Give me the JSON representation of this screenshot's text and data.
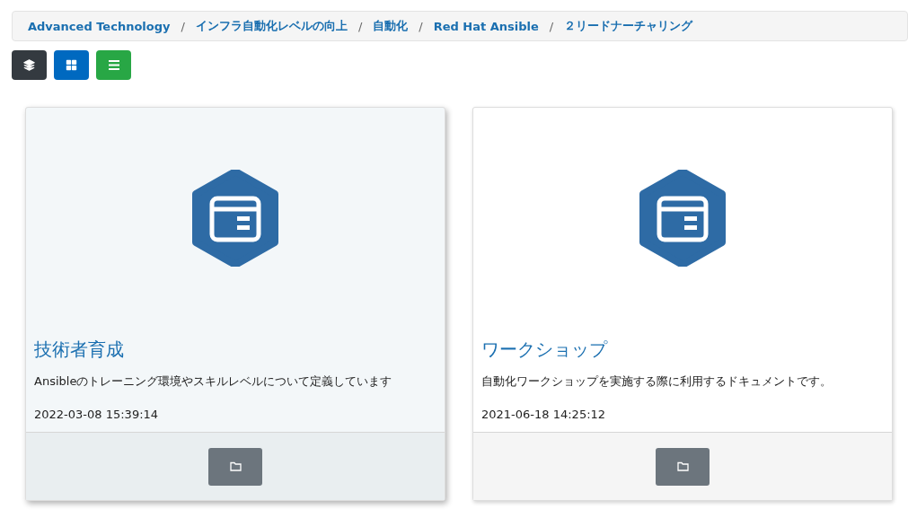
{
  "breadcrumb": [
    {
      "label": "Advanced Technology"
    },
    {
      "separator": "/",
      "label": "インフラ自動化レベルの向上"
    },
    {
      "separator": "/",
      "label": "自動化"
    },
    {
      "separator": "/",
      "label": "Red Hat Ansible"
    },
    {
      "separator": "/",
      "label": "２リードナーチャリング"
    }
  ],
  "view_buttons": [
    {
      "kind": "layers",
      "color": "#343a40"
    },
    {
      "kind": "grid",
      "color": "#0069c0"
    },
    {
      "kind": "list",
      "color": "#28a745"
    }
  ],
  "cards": [
    {
      "title": "技術者育成",
      "description": "Ansibleのトレーニング環境やスキルレベルについて定義しています",
      "date": "2022-03-08 15:39:14",
      "highlighted": true
    },
    {
      "title": "ワークショップ",
      "description": "自動化ワークショップを実施する際に利用するドキュメントです。",
      "date": "2021-06-18 14:25:12",
      "highlighted": false
    }
  ]
}
